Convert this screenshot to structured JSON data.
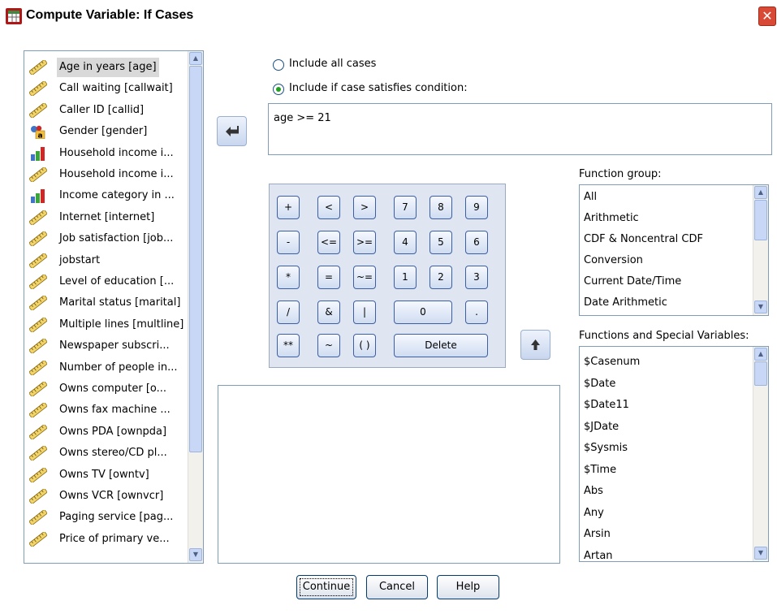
{
  "window": {
    "title": "Compute Variable: If Cases",
    "close_glyph": "✕"
  },
  "variables": [
    {
      "label": "Age in years [age]",
      "icon": "ruler-icon",
      "selected": true
    },
    {
      "label": "Call waiting [callwait]",
      "icon": "ruler-icon"
    },
    {
      "label": "Caller ID [callid]",
      "icon": "ruler-icon"
    },
    {
      "label": "Gender [gender]",
      "icon": "nominal-icon"
    },
    {
      "label": "Household income i...",
      "icon": "ordinal-icon"
    },
    {
      "label": "Household income i...",
      "icon": "ruler-icon"
    },
    {
      "label": "Income category in ...",
      "icon": "ordinal-icon"
    },
    {
      "label": "Internet [internet]",
      "icon": "ruler-icon"
    },
    {
      "label": "Job satisfaction [job...",
      "icon": "ruler-icon"
    },
    {
      "label": "jobstart",
      "icon": "ruler-icon"
    },
    {
      "label": "Level of education [...",
      "icon": "ruler-icon"
    },
    {
      "label": "Marital status [marital]",
      "icon": "ruler-icon"
    },
    {
      "label": "Multiple lines [multline]",
      "icon": "ruler-icon"
    },
    {
      "label": "Newspaper subscri...",
      "icon": "ruler-icon"
    },
    {
      "label": "Number of people in...",
      "icon": "ruler-icon"
    },
    {
      "label": "Owns computer [o...",
      "icon": "ruler-icon"
    },
    {
      "label": "Owns fax machine ...",
      "icon": "ruler-icon"
    },
    {
      "label": "Owns PDA [ownpda]",
      "icon": "ruler-icon"
    },
    {
      "label": "Owns stereo/CD pl...",
      "icon": "ruler-icon"
    },
    {
      "label": "Owns TV [owntv]",
      "icon": "ruler-icon"
    },
    {
      "label": "Owns VCR [ownvcr]",
      "icon": "ruler-icon"
    },
    {
      "label": "Paging service [pag...",
      "icon": "ruler-icon"
    },
    {
      "label": "Price of primary ve...",
      "icon": "ruler-icon"
    }
  ],
  "options": {
    "include_all": "Include all cases",
    "include_if": "Include if case satisfies condition:",
    "selected": "include_if"
  },
  "condition": "age >= 21",
  "keypad": {
    "keys": [
      "+",
      "<",
      ">",
      "7",
      "8",
      "9",
      "-",
      "<=",
      ">=",
      "4",
      "5",
      "6",
      "*",
      "=",
      "~=",
      "1",
      "2",
      "3",
      "/",
      "&",
      "|",
      "0",
      ".",
      "**",
      "~",
      "( )",
      "Delete"
    ]
  },
  "function_group": {
    "label": "Function group:",
    "items": [
      "All",
      "Arithmetic",
      "CDF & Noncentral CDF",
      "Conversion",
      "Current Date/Time",
      "Date Arithmetic"
    ]
  },
  "functions": {
    "label": "Functions and Special Variables:",
    "items": [
      "$Casenum",
      "$Date",
      "$Date11",
      "$JDate",
      "$Sysmis",
      "$Time",
      "Abs",
      "Any",
      "Arsin",
      "Artan"
    ]
  },
  "buttons": {
    "continue": "Continue",
    "cancel": "Cancel",
    "help": "Help"
  },
  "colors": {
    "selection": "#d9d9d9",
    "radio_dot": "#21a121",
    "close": "#d84a35"
  }
}
